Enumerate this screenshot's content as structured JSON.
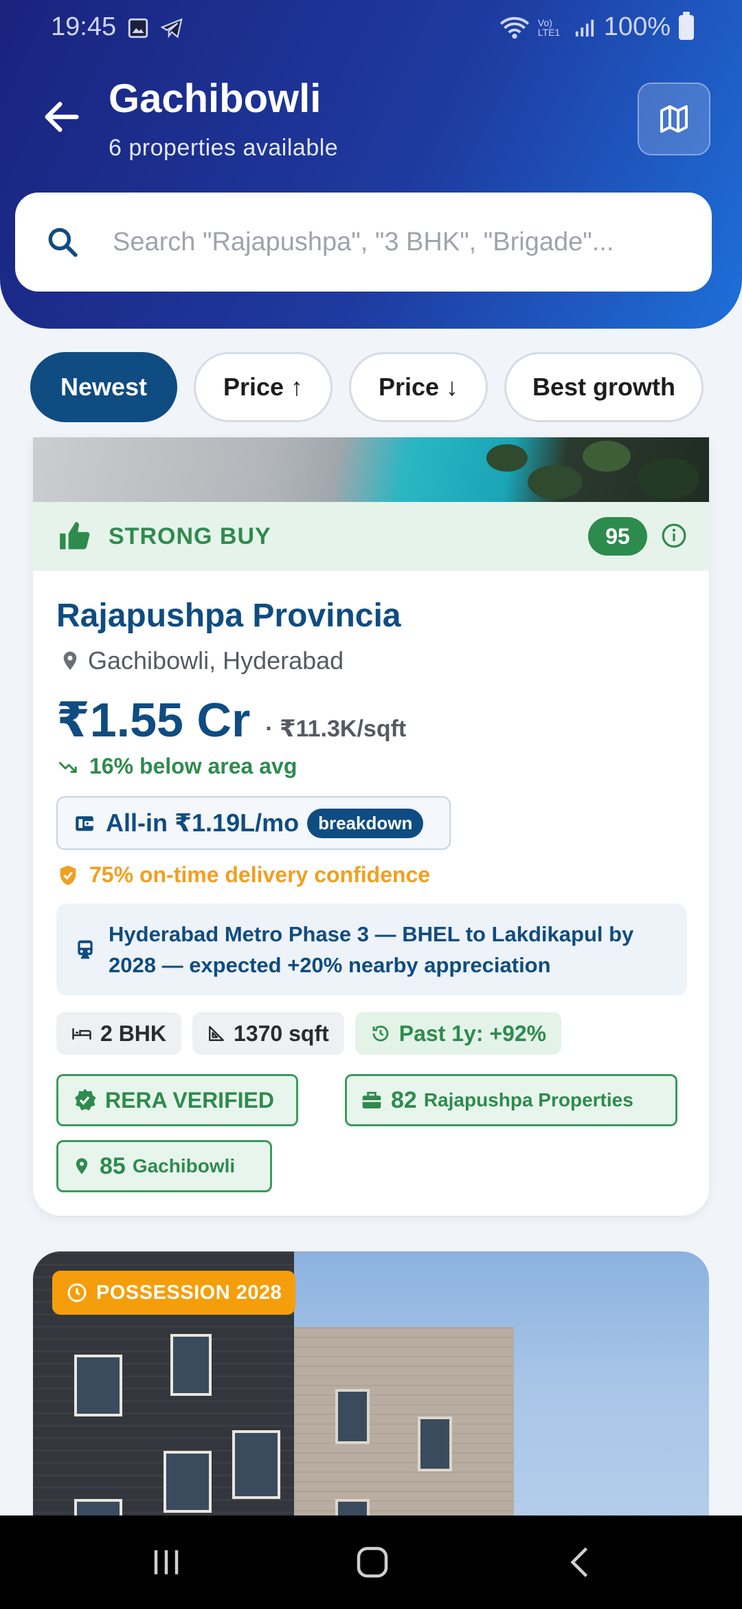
{
  "status_bar": {
    "time": "19:45",
    "battery": "100%",
    "network": "Vo) LTE1"
  },
  "header": {
    "title": "Gachibowli",
    "subtitle": "6 properties available"
  },
  "search": {
    "placeholder": "Search \"Rajapushpa\", \"3 BHK\", \"Brigade\"..."
  },
  "sort_chips": [
    {
      "label": "Newest",
      "active": true
    },
    {
      "label": "Price ↑",
      "active": false
    },
    {
      "label": "Price ↓",
      "active": false
    },
    {
      "label": "Best growth",
      "active": false
    }
  ],
  "listing_1": {
    "verdict": "STRONG BUY",
    "score": "95",
    "name": "Rajapushpa Provincia",
    "location": "Gachibowli, Hyderabad",
    "price": "₹1.55 Cr",
    "price_per_sqft": "· ₹11.3K/sqft",
    "below_avg": "16% below area avg",
    "all_in": "All-in ₹1.19L/mo",
    "breakdown_label": "breakdown",
    "delivery_confidence": "75% on-time delivery confidence",
    "metro_note": "Hyderabad Metro Phase 3 — BHEL to Lakdikapul by 2028 — expected +20% nearby appreciation",
    "specs": {
      "bhk": "2 BHK",
      "area": "1370 sqft",
      "past_growth": "Past 1y: +92%"
    },
    "badges": {
      "rera": "RERA VERIFIED",
      "builder_score": "82",
      "builder_name": "Rajapushpa Properties",
      "location_score": "85",
      "location_name": "Gachibowli"
    }
  },
  "listing_2": {
    "possession": "POSSESSION 2028"
  },
  "colors": {
    "primary": "#0f4c81",
    "green": "#2e8b4e",
    "amber": "#f59e0b",
    "header_start": "#1a237e",
    "header_end": "#1e6fd9"
  }
}
